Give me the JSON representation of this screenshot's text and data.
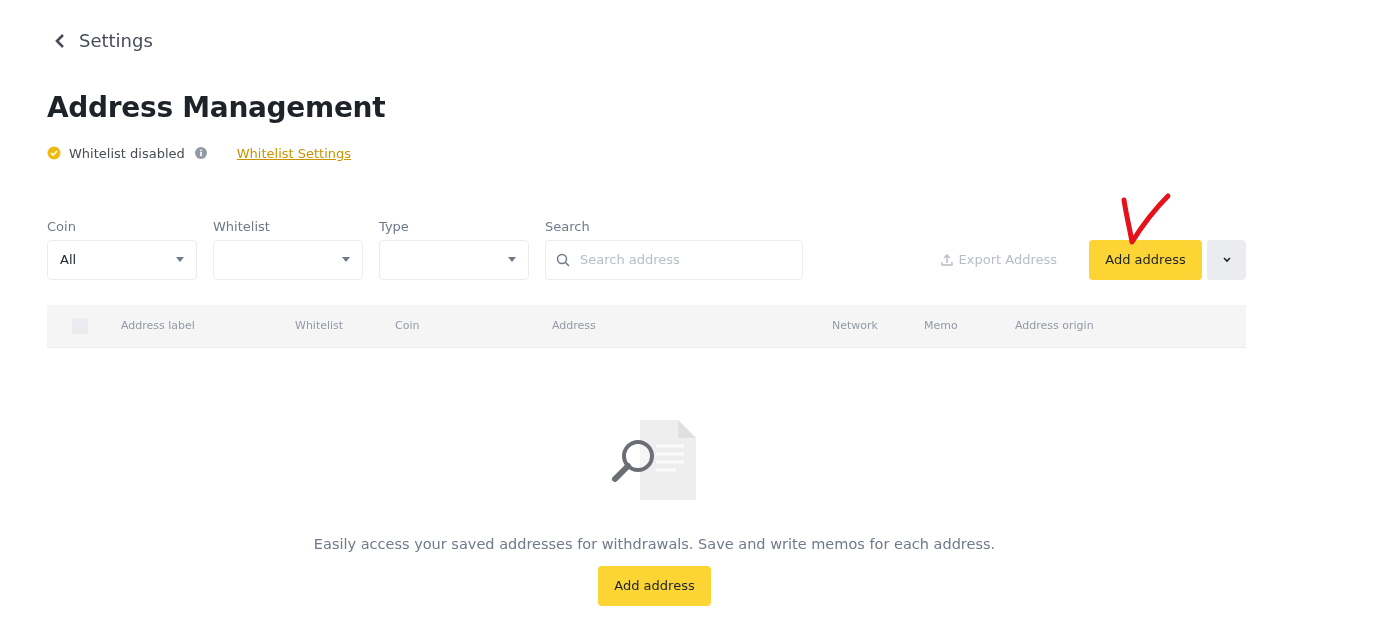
{
  "back": {
    "label": "Settings"
  },
  "title": "Address Management",
  "whitelist": {
    "status": "Whitelist disabled",
    "link": "Whitelist Settings"
  },
  "filters": [
    {
      "kind": "select",
      "label": "Coin",
      "value": "All"
    },
    {
      "kind": "select",
      "label": "Whitelist"
    },
    {
      "kind": "select",
      "label": "Type"
    },
    {
      "kind": "search",
      "label": "Search",
      "placeholder": "Search address"
    }
  ],
  "actions": {
    "export": "Export Address",
    "add": "Add address"
  },
  "table": {
    "select_all": {
      "checked": false
    },
    "columns": [
      "Address label",
      "Whitelist",
      "Coin",
      "Address",
      "Network",
      "Memo",
      "Address origin"
    ]
  },
  "empty": {
    "message": "Easily access your saved addresses for withdrawals. Save and write memos for each address.",
    "button": "Add address"
  }
}
